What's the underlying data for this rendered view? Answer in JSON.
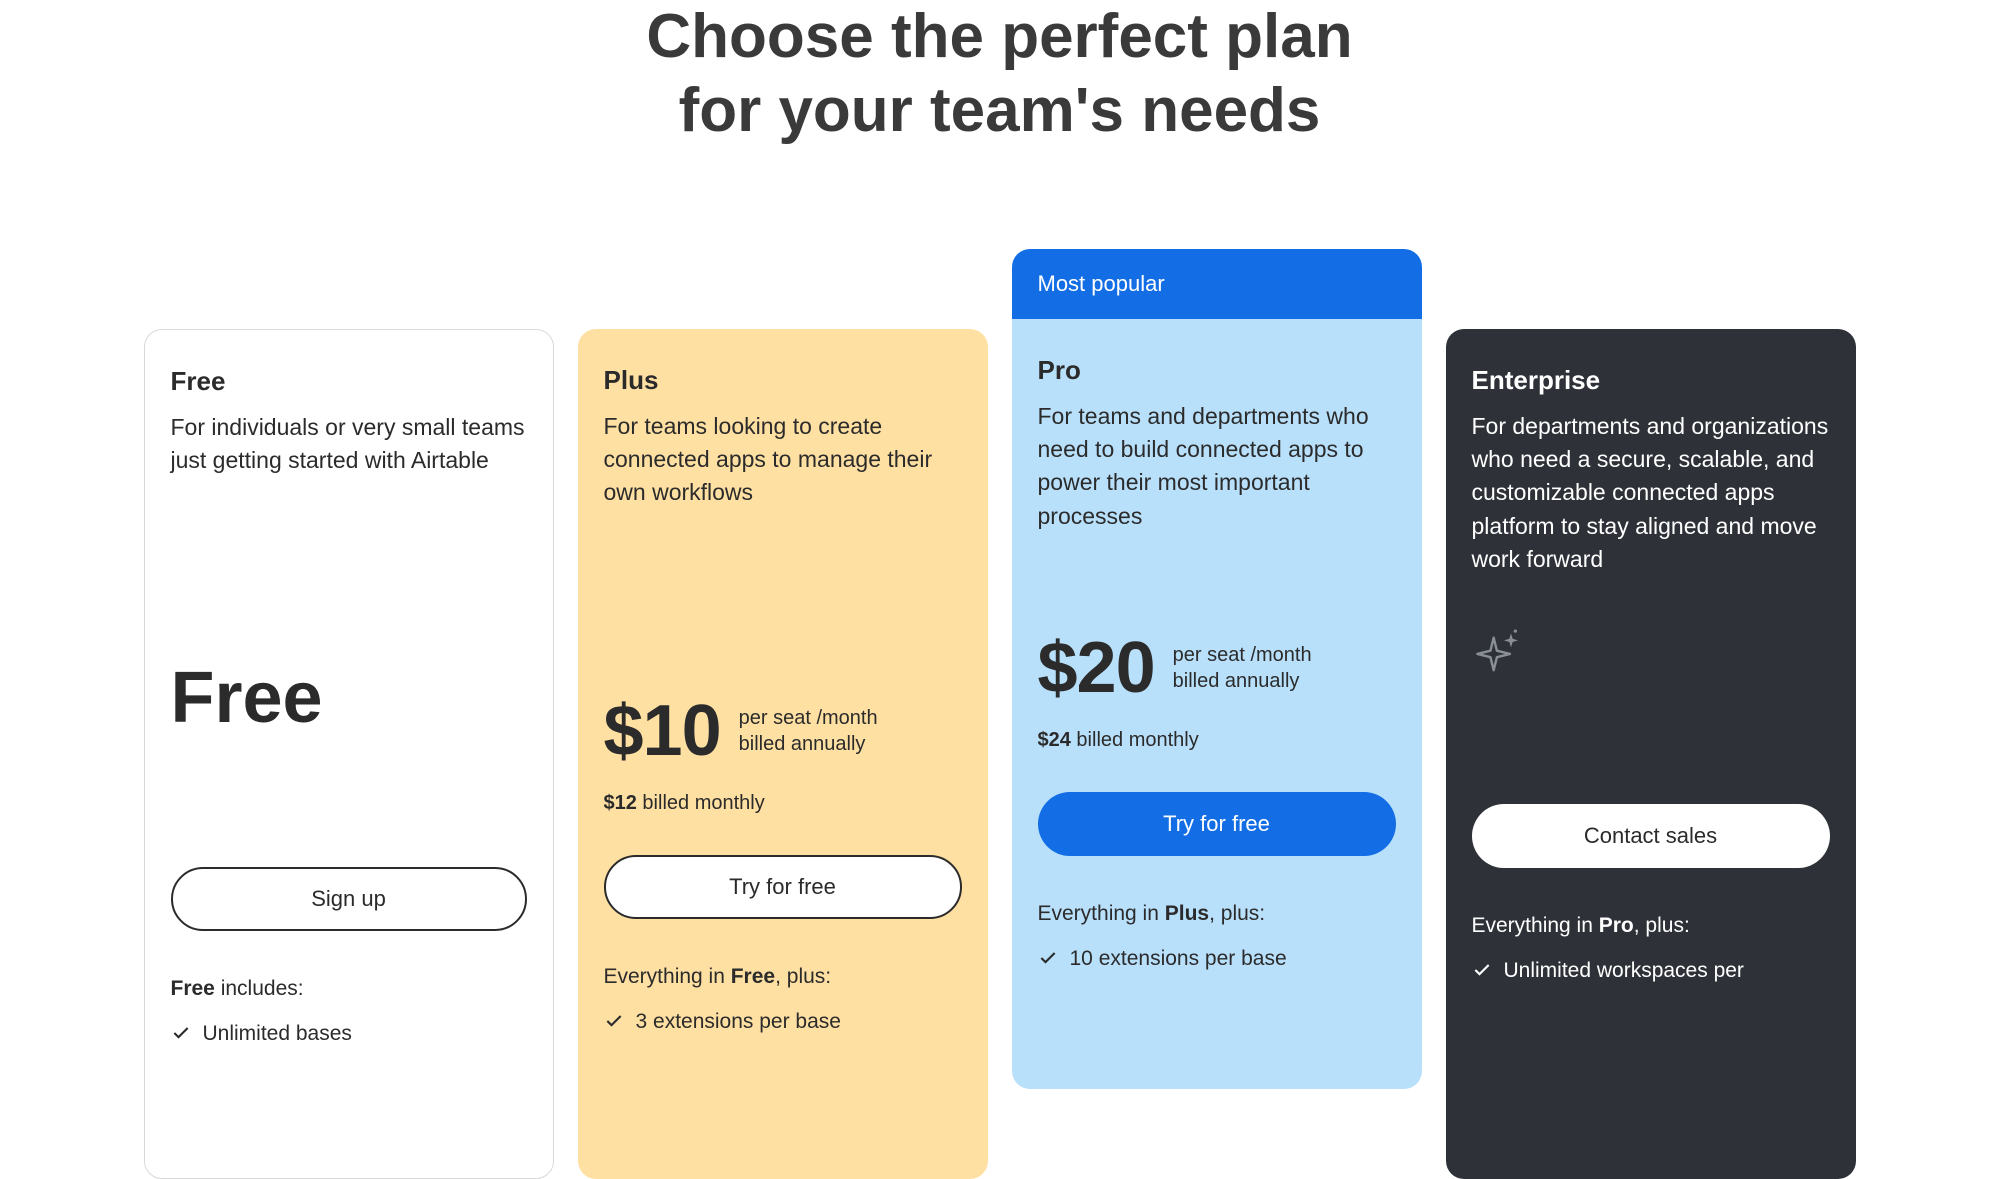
{
  "headline_line1": "Choose the perfect plan",
  "headline_line2": "for your team's needs",
  "most_popular": "Most popular",
  "plans": {
    "free": {
      "name": "Free",
      "desc": "For individuals or very small teams just getting started with Airtable",
      "price": "Free",
      "cta": "Sign up",
      "includes_prefix": "Free",
      "includes_suffix": " includes:",
      "feature0": "Unlimited bases"
    },
    "plus": {
      "name": "Plus",
      "desc": "For teams looking to create connected apps to manage their own workflows",
      "price": "$10",
      "price_sub1": "per seat /month",
      "price_sub2": "billed annually",
      "monthly_bold": "$12",
      "monthly_rest": " billed monthly",
      "cta": "Try for free",
      "includes_pre": "Everything in ",
      "includes_bold": "Free",
      "includes_post": ", plus:",
      "feature0": "3 extensions per base"
    },
    "pro": {
      "name": "Pro",
      "desc": "For teams and departments who need to build connected apps to power their most important processes",
      "price": "$20",
      "price_sub1": "per seat /month",
      "price_sub2": "billed annually",
      "monthly_bold": "$24",
      "monthly_rest": " billed monthly",
      "cta": "Try for free",
      "includes_pre": "Everything in ",
      "includes_bold": "Plus",
      "includes_post": ", plus:",
      "feature0": "10 extensions per base"
    },
    "enterprise": {
      "name": "Enterprise",
      "desc": "For departments and organizations who need a secure, scalable, and customizable connected apps platform to stay aligned and move work forward",
      "cta": "Contact sales",
      "includes_pre": "Everything in ",
      "includes_bold": "Pro",
      "includes_post": ", plus:",
      "feature0": "Unlimited workspaces per"
    }
  }
}
